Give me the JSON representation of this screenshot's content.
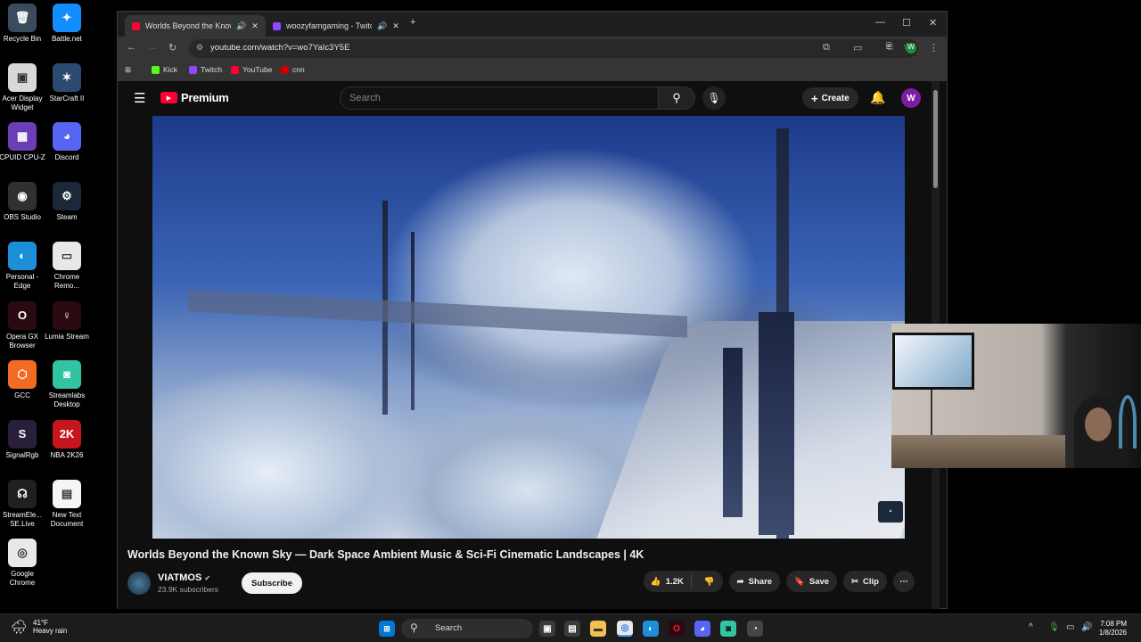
{
  "desktop": {
    "icons": [
      {
        "label": "Recycle Bin",
        "glyph": "🗑",
        "color": "#3a4b5e",
        "icon": "recycle-bin-icon"
      },
      {
        "label": "Battle.net",
        "glyph": "✦",
        "color": "#148eff",
        "icon": "battlenet-icon"
      },
      {
        "label": "Acer Display Widget",
        "glyph": "▣",
        "color": "#d8d8d8",
        "icon": "acer-display-icon"
      },
      {
        "label": "StarCraft II",
        "glyph": "✶",
        "color": "#2c4a70",
        "icon": "starcraft-icon"
      },
      {
        "label": "CPUID CPU-Z",
        "glyph": "▦",
        "color": "#6a3fb5",
        "icon": "cpuz-icon"
      },
      {
        "label": "Discord",
        "glyph": "◕",
        "color": "#5865f2",
        "icon": "discord-icon"
      },
      {
        "label": "OBS Studio",
        "glyph": "◉",
        "color": "#303030",
        "icon": "obs-icon"
      },
      {
        "label": "Steam",
        "glyph": "⚙",
        "color": "#1b2838",
        "icon": "steam-icon"
      },
      {
        "label": "Personal - Edge",
        "glyph": "◐",
        "color": "#1d8ed8",
        "icon": "edge-icon"
      },
      {
        "label": "Chrome Remo...",
        "glyph": "▭",
        "color": "#e8e8e8",
        "icon": "chrome-remote-icon"
      },
      {
        "label": "Opera GX Browser",
        "glyph": "O",
        "color": "#2a0a10",
        "icon": "opera-gx-icon"
      },
      {
        "label": "Lumia Stream",
        "glyph": "♀",
        "color": "#2a0a10",
        "icon": "lumia-icon"
      },
      {
        "label": "GCC",
        "glyph": "⬡",
        "color": "#f36b21",
        "icon": "gcc-icon"
      },
      {
        "label": "Streamlabs Desktop",
        "glyph": "◙",
        "color": "#31c3a2",
        "icon": "streamlabs-icon"
      },
      {
        "label": "SignalRgb",
        "glyph": "S",
        "color": "#2a1f3a",
        "icon": "signalrgb-icon"
      },
      {
        "label": "NBA 2K26",
        "glyph": "2K",
        "color": "#c4161c",
        "icon": "nba2k-icon"
      },
      {
        "label": "StreamEle... SE.Live",
        "glyph": "☊",
        "color": "#202020",
        "icon": "streamelements-icon"
      },
      {
        "label": "New Text Document",
        "glyph": "▤",
        "color": "#f5f5f5",
        "icon": "text-document-icon"
      },
      {
        "label": "Google Chrome",
        "glyph": "◎",
        "color": "#e8e8e8",
        "icon": "chrome-icon"
      }
    ]
  },
  "browser": {
    "tabs": [
      {
        "title": "Worlds Beyond the Known",
        "fav_color": "#ff0033"
      },
      {
        "title": "woozyfamgaming - Twitch",
        "fav_color": "#9146ff"
      }
    ],
    "url": "youtube.com/watch?v=wo7YaIc3Y5E",
    "bookmarks": [
      {
        "label": "Kick",
        "color": "#53fc18"
      },
      {
        "label": "Twitch",
        "color": "#9146ff"
      },
      {
        "label": "YouTube",
        "color": "#ff0033"
      },
      {
        "label": "cnn",
        "color": "#cc0000"
      }
    ],
    "profile_letter": "W"
  },
  "youtube": {
    "logo_text": "Premium",
    "search_placeholder": "Search",
    "create_label": "Create",
    "avatar_letter": "W",
    "video_title": "Worlds Beyond the Known Sky — Dark Space Ambient Music & Sci-Fi Cinematic Landscapes | 4K",
    "channel_name": "VIATMOS",
    "subscribers": "23.9K subscribers",
    "subscribe_label": "Subscribe",
    "likes": "1.2K",
    "share_label": "Share",
    "save_label": "Save",
    "clip_label": "Clip"
  },
  "taskbar": {
    "temperature": "41°F",
    "weather": "Heavy rain",
    "search_label": "Search",
    "time": "7:08 PM",
    "date": "1/8/2026"
  }
}
